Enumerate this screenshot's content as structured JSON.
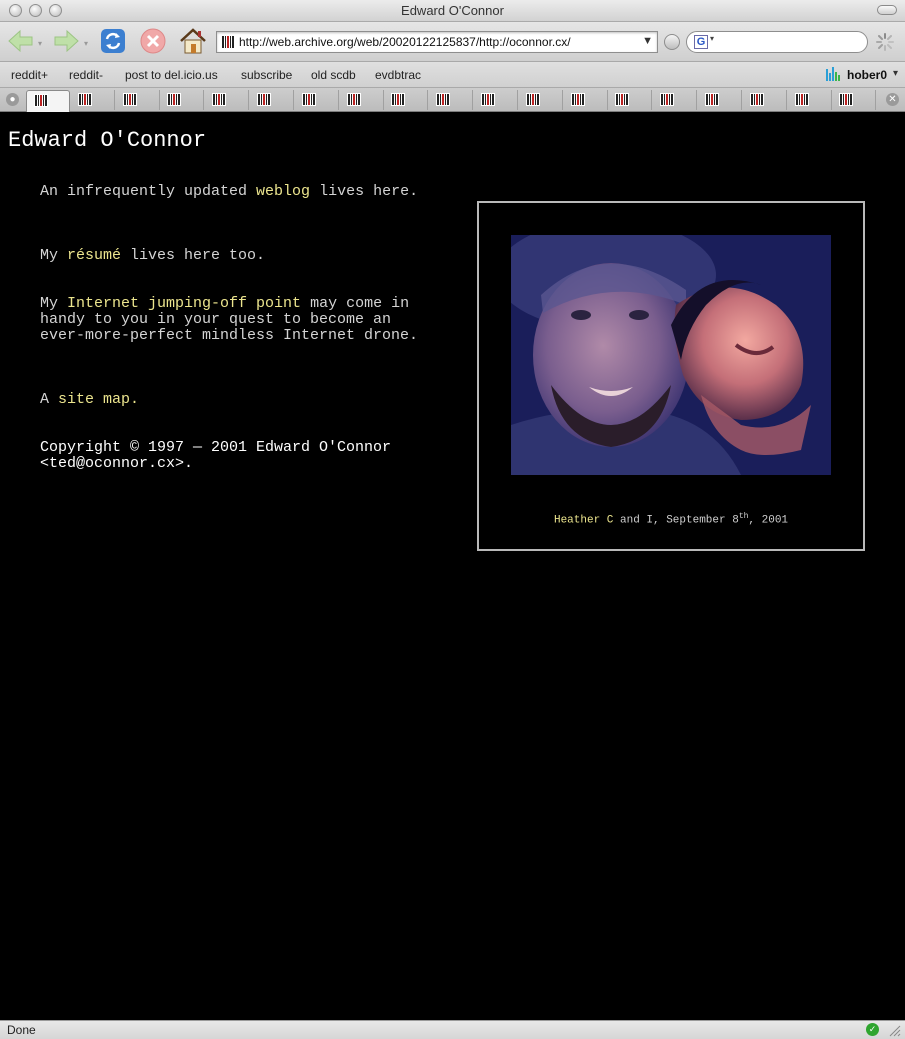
{
  "window": {
    "title": "Edward O'Connor"
  },
  "toolbar": {
    "url": "http://web.archive.org/web/20020122125837/http://oconnor.cx/",
    "search_engine": "G",
    "search_value": ""
  },
  "bookmarks": {
    "items": [
      "reddit+",
      "reddit-",
      "post to del.icio.us",
      "subscribe",
      "old scdb",
      "evdbtrac"
    ],
    "user": "hober0"
  },
  "tabs": {
    "count": 19,
    "active_index": 0
  },
  "page": {
    "heading": "Edward O'Connor",
    "p1": {
      "before": "An infrequently updated ",
      "link": "weblog",
      "after": " lives here."
    },
    "p2": {
      "before": "My ",
      "link": "résumé",
      "after": " lives here too."
    },
    "p3": {
      "before": "My ",
      "link": "Internet jumping-off point",
      "after": " may come in handy to you in your quest to become an ever-more-perfect mindless Internet drone."
    },
    "p4": {
      "before": "A ",
      "link": "site map."
    },
    "copyright": "Copyright © 1997 — 2001 Edward O'Connor <ted@oconnor.cx>.",
    "photo_caption": {
      "link": "Heather C",
      "text": " and I, September 8",
      "sup": "th",
      "tail": ", 2001"
    }
  },
  "status": {
    "text": "Done"
  },
  "colors": {
    "page_bg": "#000000",
    "text": "#d4d4d4",
    "link": "#ece58e",
    "frame": "#b9b9b9"
  }
}
